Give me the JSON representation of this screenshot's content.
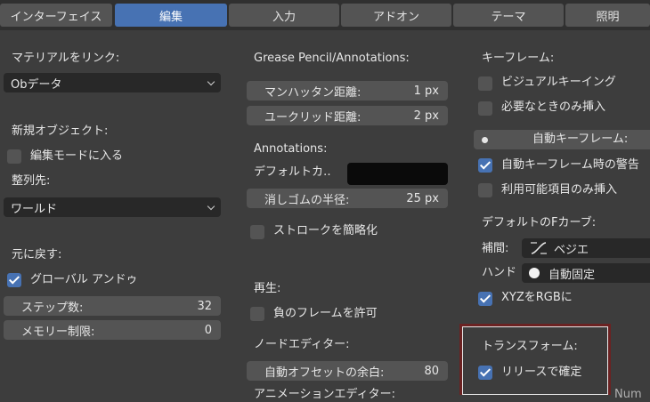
{
  "tabs": [
    {
      "label": "インターフェイス"
    },
    {
      "label": "編集"
    },
    {
      "label": "入力"
    },
    {
      "label": "アドオン"
    },
    {
      "label": "テーマ"
    },
    {
      "label": "照明"
    }
  ],
  "col1": {
    "material_link_label": "マテリアルをリンク:",
    "material_link_value": "Obデータ",
    "new_objects_label": "新規オブジェクト:",
    "enter_edit_mode": "編集モードに入る",
    "align_label": "整列先:",
    "align_value": "ワールド",
    "undo_label": "元に戻す:",
    "global_undo": "グローバル アンドゥ",
    "steps_label": "ステップ数:",
    "steps_value": "32",
    "memory_label": "メモリー制限:",
    "memory_value": "0"
  },
  "col2": {
    "grease_label": "Grease Pencil/Annotations:",
    "manhattan_label": "マンハッタン距離:",
    "manhattan_value": "1 px",
    "euclid_label": "ユークリッド距離:",
    "euclid_value": "2 px",
    "annotations_label": "Annotations:",
    "default_color_label": "デフォルトカ‥",
    "eraser_label": "消しゴムの半径:",
    "eraser_value": "25 px",
    "simplify_stroke": "ストロークを簡略化",
    "playback_label": "再生:",
    "negative_frames": "負のフレームを許可",
    "node_editor_label": "ノードエディター:",
    "auto_offset_label": "自動オフセットの余白:",
    "auto_offset_value": "80",
    "anim_editor_label": "アニメーションエディター:"
  },
  "col3": {
    "keyframes_label": "キーフレーム:",
    "visual_keying": "ビジュアルキーイング",
    "only_needed": "必要なときのみ挿入",
    "auto_keyframe": "自動キーフレーム:",
    "auto_keyframe_warning": "自動キーフレーム時の警告",
    "only_available": "利用可能項目のみ挿入",
    "fcurve_label": "デフォルトのFカーブ:",
    "interp_label": "補間:",
    "interp_value": "ベジエ",
    "handle_label": "ハンド",
    "handle_value": "自動固定",
    "xyz_rgb": "XYZをRGBに",
    "transform_label": "トランスフォーム:",
    "confirm_release": "リリースで確定",
    "cut_text": "Num"
  },
  "colors": {
    "background": "#3d3d3d",
    "accent": "#4772b3",
    "highlight_border": "#6b2222"
  }
}
